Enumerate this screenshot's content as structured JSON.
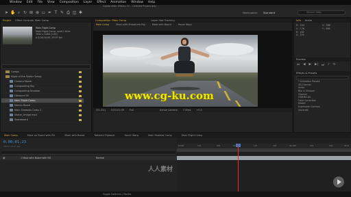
{
  "menubar": {
    "items": [
      "Window",
      "Edit",
      "File",
      "View",
      "Composition",
      "Layer",
      "Effect",
      "Animation",
      "View",
      "Window",
      "Help"
    ]
  },
  "titlebar": {
    "text": "Adobe After Effects CC - Untitled Project.aep"
  },
  "workspace": {
    "label": "Workspace:",
    "value": "Standard"
  },
  "search": {
    "placeholder": "Search Help"
  },
  "project": {
    "tab": "Project",
    "effects_tab": "Effect Controls: Main Comp",
    "comp_name": "Main Flight Comp",
    "info_lines": [
      "Main Flight Comp, used 1 time",
      "1920 x 1080 (1.00)",
      "Δ 0;00;10;00, 29.97 fps"
    ],
    "items": [
      {
        "type": "folder",
        "label": "Comps",
        "color": "#c9b84a"
      },
      {
        "type": "folder",
        "label": "Night of the Skater Setup",
        "color": "#c9b84a"
      },
      {
        "type": "comp",
        "label": "Camera Mover",
        "color": "#c9b84a"
      },
      {
        "type": "comp",
        "label": "Compositing Sky",
        "color": "#c9b84a"
      },
      {
        "type": "comp",
        "label": "Compositing Shadow",
        "color": "#c9b84a"
      },
      {
        "type": "comp",
        "label": "Distance Fill",
        "color": "#c9b84a"
      },
      {
        "type": "comp",
        "label": "Main Flight Comp",
        "color": "#c9b84a",
        "selected": true
      },
      {
        "type": "comp",
        "label": "Motion Board",
        "color": "#c9b84a"
      },
      {
        "type": "comp",
        "label": "Main Shadows Comp 1",
        "color": "#c9b84a"
      },
      {
        "type": "comp",
        "label": "Skater_Image.mp4",
        "color": "#c9b84a"
      },
      {
        "type": "comp",
        "label": "Skateboard",
        "color": "#c9b84a"
      }
    ]
  },
  "viewer": {
    "tabs": [
      "Composition: Main Comp",
      "Layer: Not Tracking"
    ],
    "sub_tabs": [
      "Main Comp",
      "Mask with Steadicam Rig",
      "Mask with Board",
      "Hover Warp"
    ],
    "watermark": "www.cg-ku.com",
    "bar": [
      "(51.4%)",
      "0;00;01;09",
      "Full",
      "Active Camera",
      "1 View",
      "+0.0"
    ]
  },
  "info_panel": {
    "tabs": [
      "Info",
      "Audio"
    ],
    "lines": [
      "R : 184",
      "G : 176",
      "B : 162",
      "A : 255",
      "X : 566",
      "Y : 388"
    ]
  },
  "preview_panel": {
    "title": "Preview"
  },
  "effects_panel": {
    "title": "Effects & Presets",
    "items": [
      "* Animation Presets",
      "3D Channel",
      "Audio",
      "Blur & Sharpen",
      "Channel",
      "CINEMA 4D",
      "Color Correction",
      "Distort",
      "Expression Controls",
      "Generate"
    ]
  },
  "timeline": {
    "tabs": [
      "Main Comp",
      "Mask on Board with RG",
      "Mask with Board",
      "Tattered Flipbook",
      "Hover Warp",
      "Main Shadow Comp",
      "Main Flight Comp"
    ],
    "timecode": "0;00;01;23",
    "timecode_sub": "00053 (29.97 fps)",
    "layer": "1  Mask with Board with RG",
    "layer_mode": "Normal",
    "ruler": [
      "0;00f",
      "10f",
      "20f",
      "01;00f",
      "10f",
      "20f",
      "02;00f",
      "10f",
      "20f",
      "03;0"
    ]
  },
  "status": {
    "text": "Toggle Switches / Modes"
  },
  "logo": {
    "text": "人人素材"
  }
}
